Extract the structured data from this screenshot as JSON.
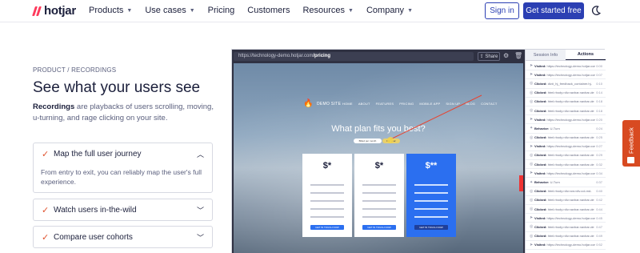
{
  "nav": {
    "logo": "hotjar",
    "menu": [
      {
        "label": "Products",
        "has_dropdown": true
      },
      {
        "label": "Use cases",
        "has_dropdown": true
      },
      {
        "label": "Pricing",
        "has_dropdown": false
      },
      {
        "label": "Customers",
        "has_dropdown": false
      },
      {
        "label": "Resources",
        "has_dropdown": true
      },
      {
        "label": "Company",
        "has_dropdown": true
      }
    ],
    "signin_label": "Sign in",
    "cta_label": "Get started free",
    "theme_icon": "moon-icon"
  },
  "hero": {
    "eyebrow": "PRODUCT / RECORDINGS",
    "headline": "See what your users see",
    "desc_strong": "Recordings",
    "desc_rest": " are playbacks of users scrolling, moving, u-turning, and rage clicking on your site."
  },
  "accordion": [
    {
      "title": "Map the full user journey",
      "expanded": true,
      "body": "From entry to exit, you can reliably map the user's full experience."
    },
    {
      "title": "Watch users in-the-wild",
      "expanded": false
    },
    {
      "title": "Compare user cohorts",
      "expanded": false
    }
  ],
  "mock": {
    "url_prefix": "https://technology-demo.hotjar.com",
    "url_path": "/pricing",
    "share_label": "Share",
    "site": {
      "name": "DEMO SITE",
      "links": [
        "HOME",
        "ABOUT",
        "FEATURES",
        "PRICING",
        "MOBILE APP",
        "SIGN UP",
        "BLOG",
        "CONTACT"
      ],
      "hero": "What plan fits you best?",
      "pill1": "Billed per month",
      "pill2": "Per year",
      "prices": [
        "$*",
        "$*",
        "$**"
      ],
      "button": "GET IN TOUCH NOW"
    },
    "tabs": [
      "Session Info",
      "Actions"
    ],
    "events": [
      {
        "icon": "arrow-icon",
        "kind": "Visited:",
        "text": "https://technology-demo.hotjar.com/",
        "time": "0:00"
      },
      {
        "icon": "arrow-icon",
        "kind": "Visited:",
        "text": "https://technology-demo.hotjar.com/",
        "time": "0:07"
      },
      {
        "icon": "click-icon",
        "kind": "Clicked:",
        "text": "div#_hj_feedback_container.hj-",
        "time": "0:10"
      },
      {
        "icon": "click-icon",
        "kind": "Clicked:",
        "text": "html>body>div.navbar.navbar-de",
        "time": "0:14"
      },
      {
        "icon": "click-icon",
        "kind": "Clicked:",
        "text": "html>body>div.navbar.navbar-de",
        "time": "0:18"
      },
      {
        "icon": "click-icon",
        "kind": "Clicked:",
        "text": "html>body>div.navbar.navbar-de",
        "time": "0:18"
      },
      {
        "icon": "arrow-icon",
        "kind": "Visited:",
        "text": "https://technology-demo.hotjar.com/",
        "time": "0:20"
      },
      {
        "icon": "star-icon",
        "kind": "Behavior:",
        "text": "U-Turn",
        "time": "0:24"
      },
      {
        "icon": "click-icon",
        "kind": "Clicked:",
        "text": "html>body>div.navbar.navbar-de",
        "time": "0:25"
      },
      {
        "icon": "arrow-icon",
        "kind": "Visited:",
        "text": "https://technology-demo.hotjar.com/",
        "time": "0:27"
      },
      {
        "icon": "click-icon",
        "kind": "Clicked:",
        "text": "html>body>div.navbar.navbar-de",
        "time": "0:29"
      },
      {
        "icon": "click-icon",
        "kind": "Clicked:",
        "text": "html>body>div.navbar.navbar-de",
        "time": "0:32"
      },
      {
        "icon": "arrow-icon",
        "kind": "Visited:",
        "text": "https://technology-demo.hotjar.com/",
        "time": "0:34"
      },
      {
        "icon": "star-icon",
        "kind": "Behavior:",
        "text": "U-Turn",
        "time": "0:37"
      },
      {
        "icon": "click-icon",
        "kind": "Clicked:",
        "text": "html>body>div.row>div.col-md-",
        "time": "0:40"
      },
      {
        "icon": "click-icon",
        "kind": "Clicked:",
        "text": "html>body>div.navbar.navbar-de",
        "time": "0:42"
      },
      {
        "icon": "click-icon",
        "kind": "Clicked:",
        "text": "html>body>div.navbar.navbar-de",
        "time": "0:44"
      },
      {
        "icon": "arrow-icon",
        "kind": "Visited:",
        "text": "https://technology-demo.hotjar.com/",
        "time": "0:45"
      },
      {
        "icon": "click-icon",
        "kind": "Clicked:",
        "text": "html>body>div.navbar.navbar-de",
        "time": "0:47"
      },
      {
        "icon": "click-icon",
        "kind": "Clicked:",
        "text": "html>body>div.navbar.navbar-de",
        "time": "0:49"
      },
      {
        "icon": "arrow-icon",
        "kind": "Visited:",
        "text": "https://technology-demo.hotjar.com/",
        "time": "0:52"
      }
    ]
  },
  "feedback_label": "Feedback",
  "colors": {
    "brand_blue": "#2b3fb3",
    "logo_red": "#fd3a5c",
    "check_orange": "#e0522d",
    "feedback_orange": "#d84a21"
  }
}
